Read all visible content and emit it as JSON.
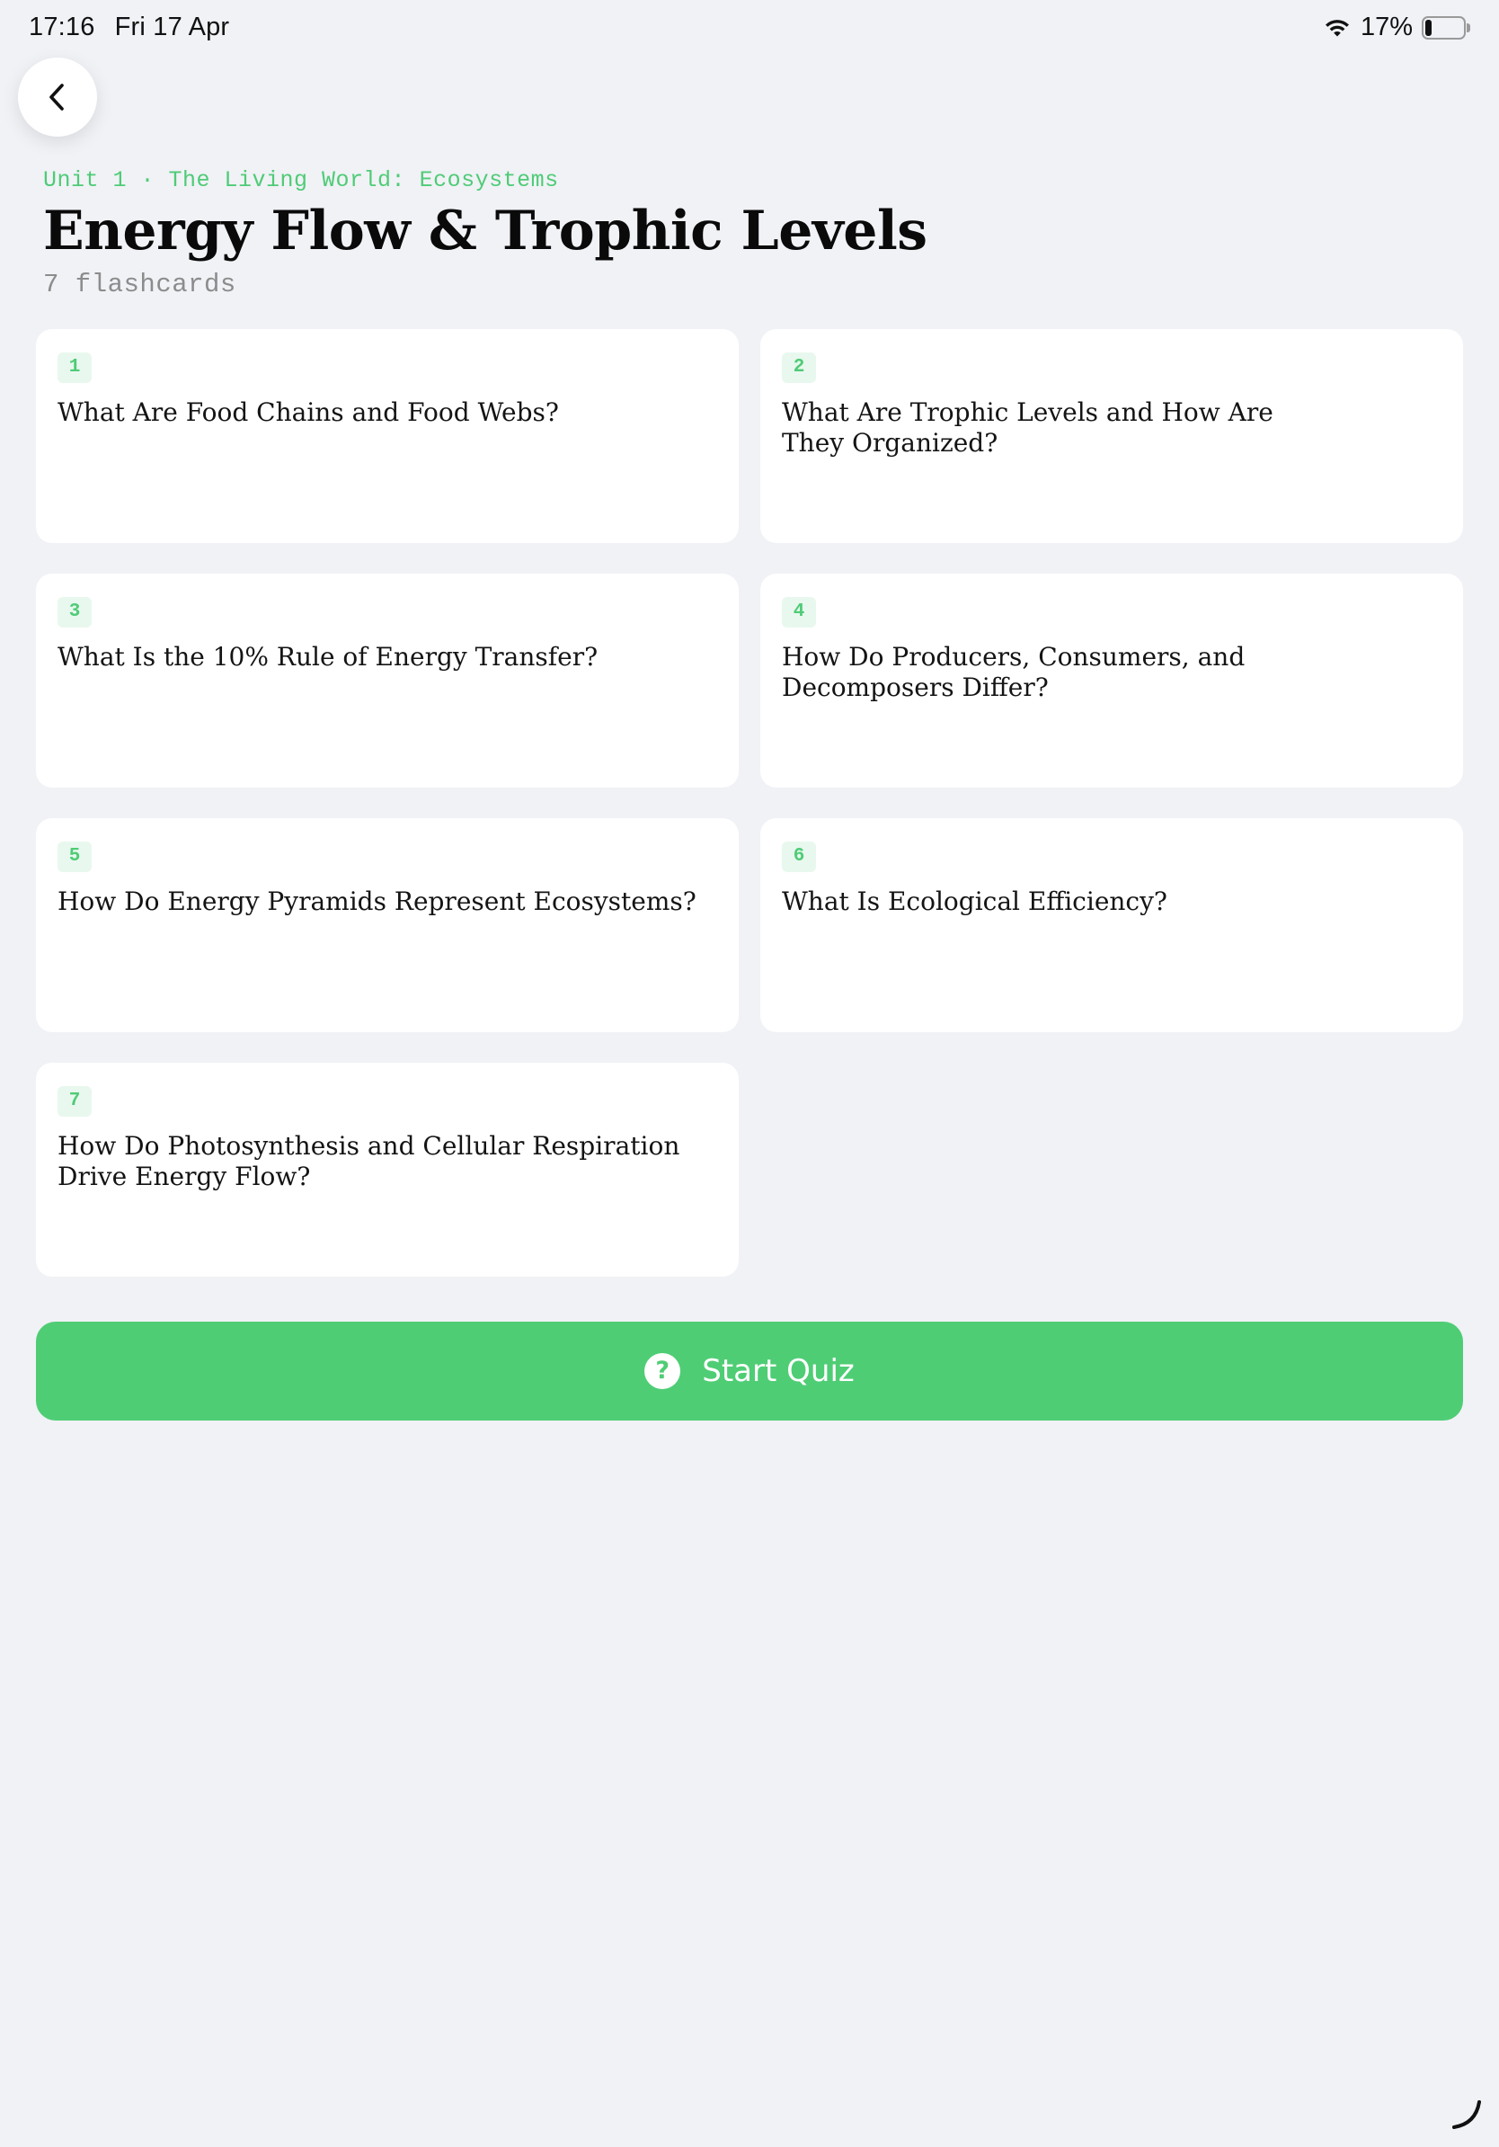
{
  "status_bar": {
    "time": "17:16",
    "date": "Fri 17 Apr",
    "battery_percent_label": "17%",
    "battery_level": 0.17,
    "wifi_icon": "wifi-icon",
    "battery_icon": "battery-icon"
  },
  "navigation": {
    "back_icon": "chevron-left-icon"
  },
  "header": {
    "breadcrumb": "Unit 1 · The Living World: Ecosystems",
    "title": "Energy Flow & Trophic Levels",
    "count_label": "7 flashcards"
  },
  "flashcards": [
    {
      "number": "1",
      "title": "What Are Food Chains and Food Webs?"
    },
    {
      "number": "2",
      "title": "What Are Trophic Levels and How Are They Organized?"
    },
    {
      "number": "3",
      "title": "What Is the 10% Rule of Energy Transfer?"
    },
    {
      "number": "4",
      "title": "How Do Producers, Consumers, and Decomposers Differ?"
    },
    {
      "number": "5",
      "title": "How Do Energy Pyramids Represent Ecosystems?"
    },
    {
      "number": "6",
      "title": "What Is Ecological Efficiency?"
    },
    {
      "number": "7",
      "title": "How Do Photosynthesis and Cellular Respiration Drive Energy Flow?"
    }
  ],
  "quiz_button": {
    "label": "Start Quiz",
    "icon_glyph": "?",
    "icon": "question-circle-icon"
  },
  "colors": {
    "accent": "#4fcd75",
    "background": "#f0f2f6",
    "card": "#ffffff",
    "badge_bg": "#e8f8ee"
  }
}
